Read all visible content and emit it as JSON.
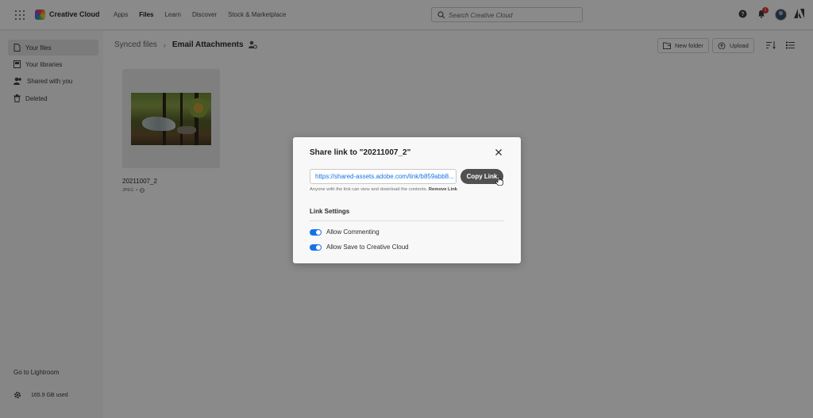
{
  "topbar": {
    "brand": "Creative Cloud",
    "nav": [
      "Apps",
      "Files",
      "Learn",
      "Discover",
      "Stock & Marketplace"
    ],
    "active_nav": "Files",
    "search_placeholder": "Search Creative Cloud",
    "notification_count": "1",
    "icons": [
      "waffle-icon",
      "help-icon",
      "bell-icon",
      "adobe-icon"
    ]
  },
  "sidebar": {
    "items": [
      {
        "label": "Your files",
        "icon": "file-icon",
        "active": true
      },
      {
        "label": "Your libraries",
        "icon": "library-icon",
        "active": false
      },
      {
        "label": "Shared with you",
        "icon": "people-icon",
        "active": false
      },
      {
        "label": "Deleted",
        "icon": "trash-icon",
        "active": false
      }
    ],
    "lightroom": "Go to Lightroom",
    "storage": "165.9 GB used"
  },
  "main": {
    "breadcrumb": [
      "Synced files",
      "Email Attachments"
    ],
    "toolbar": {
      "new_folder": "New folder",
      "upload": "Upload"
    },
    "files": [
      {
        "name": "20211007_2",
        "type": "JPEG",
        "shared": true
      }
    ]
  },
  "dialog": {
    "title": "Share link to \"20211007_2\"",
    "link_value": "https://shared-assets.adobe.com/link/b859abb8...",
    "copy_label": "Copy Link",
    "help_text": "Anyone with the link can view and download the contents.",
    "remove_link": "Remove Link",
    "settings_heading": "Link Settings",
    "toggles": [
      {
        "label": "Allow Commenting",
        "on": true
      },
      {
        "label": "Allow Save to Creative Cloud",
        "on": true
      }
    ]
  },
  "colors": {
    "accent": "#1473e6",
    "overlay": "rgba(0,0,0,0.46)",
    "badge": "#d7373f"
  }
}
